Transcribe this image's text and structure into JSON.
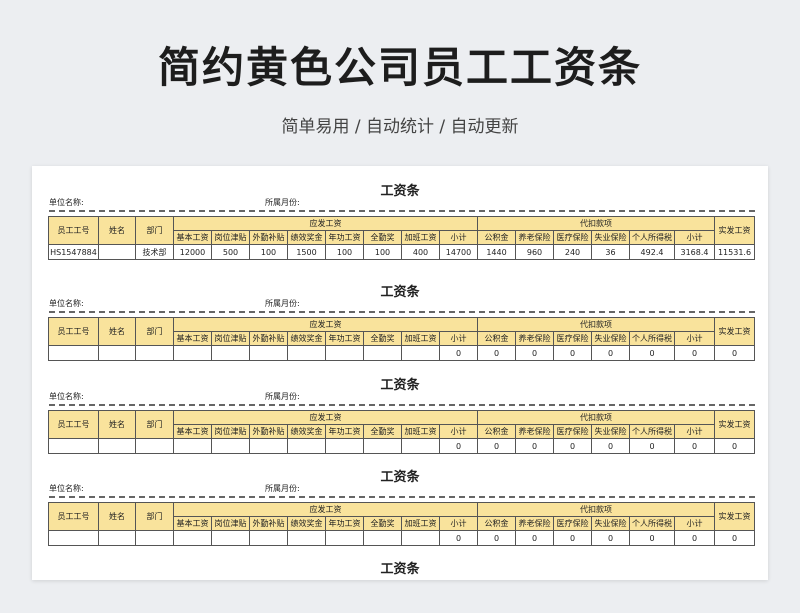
{
  "hero": {
    "title": "简约黄色公司员工工资条",
    "subtitle": "简单易用  /  自动统计  /  自动更新"
  },
  "labels": {
    "slip_title": "工资条",
    "unit_name": "单位名称:",
    "month": "所属月份:",
    "emp_id": "员工工号",
    "name": "姓名",
    "dept": "部门",
    "gross": "应发工资",
    "deduct": "代扣款项",
    "net": "实发工资",
    "gross_items": [
      "基本工资",
      "岗位津贴",
      "外勤补贴",
      "绩效奖金",
      "年功工资",
      "全勤奖",
      "加班工资",
      "小计"
    ],
    "deduct_items": [
      "公积金",
      "养老保险",
      "医疗保险",
      "失业保险",
      "个人所得税",
      "小计"
    ]
  },
  "slips": [
    {
      "emp_id": "HS1547884",
      "name": "",
      "dept": "技术部",
      "gross": [
        "12000",
        "500",
        "100",
        "1500",
        "100",
        "100",
        "400",
        "14700"
      ],
      "deduct": [
        "1440",
        "960",
        "240",
        "36",
        "492.4",
        "3168.4"
      ],
      "net": "11531.6"
    },
    {
      "emp_id": "",
      "name": "",
      "dept": "",
      "gross": [
        "",
        "",
        "",
        "",
        "",
        "",
        "",
        "0"
      ],
      "deduct": [
        "0",
        "0",
        "0",
        "0",
        "0",
        "0"
      ],
      "net": "0"
    },
    {
      "emp_id": "",
      "name": "",
      "dept": "",
      "gross": [
        "",
        "",
        "",
        "",
        "",
        "",
        "",
        "0"
      ],
      "deduct": [
        "0",
        "0",
        "0",
        "0",
        "0",
        "0"
      ],
      "net": "0"
    },
    {
      "emp_id": "",
      "name": "",
      "dept": "",
      "gross": [
        "",
        "",
        "",
        "",
        "",
        "",
        "",
        "0"
      ],
      "deduct": [
        "0",
        "0",
        "0",
        "0",
        "0",
        "0"
      ],
      "net": "0"
    }
  ]
}
